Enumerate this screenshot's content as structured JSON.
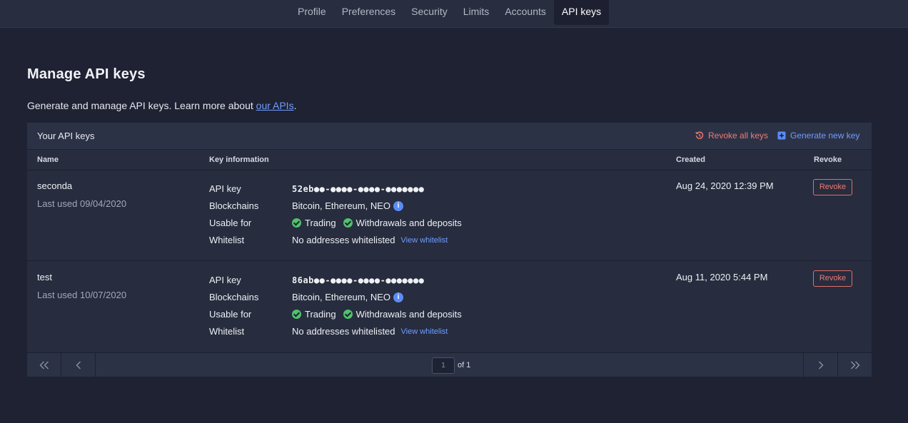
{
  "nav": {
    "tabs": [
      {
        "label": "Profile"
      },
      {
        "label": "Preferences"
      },
      {
        "label": "Security"
      },
      {
        "label": "Limits"
      },
      {
        "label": "Accounts"
      },
      {
        "label": "API keys",
        "active": true
      }
    ]
  },
  "page": {
    "title": "Manage API keys",
    "intro_text": "Generate and manage API keys. Learn more about ",
    "intro_link": "our APIs",
    "intro_end": "."
  },
  "card": {
    "title": "Your API keys",
    "revoke_all_label": "Revoke all keys",
    "generate_label": "Generate new key",
    "columns": {
      "name": "Name",
      "key_info": "Key information",
      "created": "Created",
      "revoke": "Revoke"
    },
    "labels": {
      "api_key": "API key",
      "blockchains": "Blockchains",
      "usable_for": "Usable for",
      "whitelist": "Whitelist"
    },
    "keys": [
      {
        "name": "seconda",
        "last_used": "Last used 09/04/2020",
        "api_key": "52eb●●-●●●●-●●●●-●●●●●●●",
        "blockchains": "Bitcoin, Ethereum, NEO",
        "usable_for": [
          "Trading",
          "Withdrawals and deposits"
        ],
        "whitelist": "No addresses whitelisted",
        "view_whitelist": "View whitelist",
        "created": "Aug 24, 2020 12:39 PM",
        "revoke_label": "Revoke"
      },
      {
        "name": "test",
        "last_used": "Last used 10/07/2020",
        "api_key": "86ab●●-●●●●-●●●●-●●●●●●●",
        "blockchains": "Bitcoin, Ethereum, NEO",
        "usable_for": [
          "Trading",
          "Withdrawals and deposits"
        ],
        "whitelist": "No addresses whitelisted",
        "view_whitelist": "View whitelist",
        "created": "Aug 11, 2020 5:44 PM",
        "revoke_label": "Revoke"
      }
    ]
  },
  "pagination": {
    "current_page": "1",
    "of_total": "of 1"
  },
  "colors": {
    "background": "#1e2233",
    "card": "#272c3e",
    "accent_blue": "#6f9dff",
    "danger": "#f07a73",
    "success": "#4fc26b"
  }
}
